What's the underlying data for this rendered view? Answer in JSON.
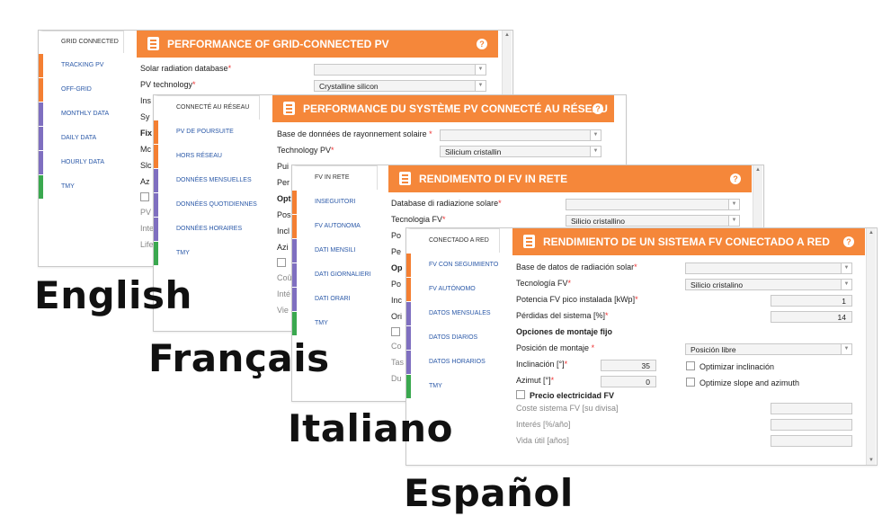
{
  "en": {
    "sidebar": [
      "GRID CONNECTED",
      "TRACKING PV",
      "OFF-GRID",
      "MONTHLY DATA",
      "DAILY DATA",
      "HOURLY DATA",
      "TMY"
    ],
    "title": "PERFORMANCE OF GRID-CONNECTED PV",
    "rows": [
      "Solar radiation database",
      "PV technology",
      "Ins",
      "Sy",
      "Fix",
      "Mc",
      "Slc",
      "Az",
      "PV",
      "Inte",
      "Life"
    ],
    "tech_value": "Crystalline silicon"
  },
  "fr": {
    "sidebar": [
      "CONNECTÉ AU RÉSEAU",
      "PV DE POURSUITE",
      "HORS RÉSEAU",
      "DONNÉES MENSUELLES",
      "DONNÉES QUOTIDIENNES",
      "DONNÉES HORAIRES",
      "TMY"
    ],
    "title": "PERFORMANCE DU SYSTÈME PV CONNECTÉ AU RÉSEAU",
    "rows": [
      "Base de données de rayonnement solaire",
      "Technology PV",
      "Pui",
      "Per",
      "Opt",
      "Pos",
      "Incl",
      "Azi",
      "Coû",
      "Inté",
      "Vie"
    ],
    "tech_value": "Silicium cristallin"
  },
  "it": {
    "sidebar": [
      "FV IN RETE",
      "INSEGUITORI",
      "FV AUTONOMA",
      "DATI MENSILI",
      "DATI GIORNALIERI",
      "DATI ORARI",
      "TMY"
    ],
    "title": "RENDIMENTO DI FV IN RETE",
    "rows": [
      "Database di radiazione solare",
      "Tecnologia FV",
      "Po",
      "Pe",
      "Op",
      "Po",
      "Inc",
      "Ori",
      "Co",
      "Tas",
      "Du"
    ],
    "tech_value": "Silicio cristallino"
  },
  "es": {
    "sidebar": [
      "CONECTADO A RED",
      "FV CON SEGUIMIENTO",
      "FV AUTÓNOMO",
      "DATOS MENSUALES",
      "DATOS DIARIOS",
      "DATOS HORARIOS",
      "TMY"
    ],
    "title": "RENDIMIENTO DE UN SISTEMA FV CONECTADO A RED",
    "radiation_label": "Base de datos de radiación solar",
    "tech_label": "Tecnología FV",
    "tech_value": "Silicio cristalino",
    "power_label": "Potencia FV pico instalada [kWp]",
    "power_value": "1",
    "loss_label": "Pérdidas del sistema [%]",
    "loss_value": "14",
    "mount_heading": "Opciones de montaje fijo",
    "position_label": "Posición de montaje",
    "position_value": "Posición libre",
    "incl_label": "Inclinación [°]",
    "incl_value": "35",
    "opt_incl_label": "Optimizar inclinación",
    "azimut_label": "Azimut [°]",
    "azimut_value": "0",
    "opt_slope_label": "Optimize slope and azimuth",
    "price_label": "Precio electricidad FV",
    "cost_label": "Coste sistema FV [su divisa]",
    "interest_label": "Interés [%/año]",
    "life_label": "Vida útil [años]"
  },
  "labels": {
    "english": "English",
    "french": "Français",
    "italian": "Italiano",
    "spanish": "Español"
  },
  "help_glyph": "?",
  "colors": {
    "header": "#f5873a",
    "orange": "#f47f32",
    "purple": "#7f6fc0",
    "green": "#3aa84f",
    "link": "#2b59a8"
  }
}
